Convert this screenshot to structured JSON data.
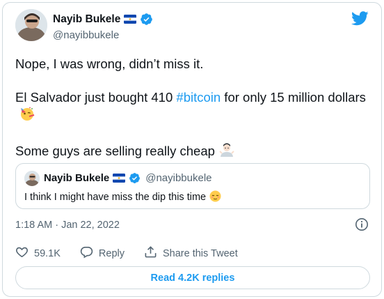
{
  "author": {
    "name": "Nayib Bukele",
    "handle": "@nayibbukele"
  },
  "tweet": {
    "line1": "Nope, I was wrong, didn’t miss it.",
    "line2_pre": "El Salvador just bought 410 ",
    "line2_hashtag": "#bitcoin",
    "line2_post": " for only 15 million dollars",
    "line3": "Some guys are selling really cheap"
  },
  "quote": {
    "name": "Nayib Bukele",
    "handle": "@nayibbukele",
    "text": "I think I might have miss the dip this time"
  },
  "timestamp": "1:18 AM · Jan 22, 2022",
  "actions": {
    "like_count": "59.1K",
    "reply_label": "Reply",
    "share_label": "Share this Tweet"
  },
  "replies_button": "Read 4.2K replies",
  "colors": {
    "accent": "#1d9bf0",
    "text": "#0f1419",
    "muted": "#536471",
    "border": "#cfd9de"
  },
  "icons": [
    "twitter-bird-icon",
    "verified-badge-icon",
    "el-salvador-flag-icon",
    "party-face-emoji",
    "man-shrugging-emoji",
    "relieved-face-emoji",
    "info-icon",
    "heart-icon",
    "reply-bubble-icon",
    "share-icon"
  ]
}
